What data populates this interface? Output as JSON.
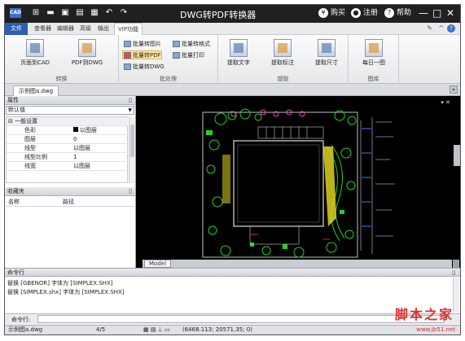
{
  "app": {
    "title": "DWG转PDF转换器",
    "icon_label": "CAD"
  },
  "titlebar": {
    "buy": "购买",
    "register": "注册",
    "help": "帮助",
    "minimize": "—",
    "maximize": "□",
    "close": "✕"
  },
  "menu_tabs": [
    "文件",
    "查看器",
    "编辑器",
    "高级",
    "输出",
    "VIP功能"
  ],
  "ribbon": {
    "groups": [
      {
        "label": "转换",
        "buttons": [
          "页面到CAD",
          "PDF到DWG"
        ]
      },
      {
        "label": "批处理",
        "buttons": [
          "批量转图片",
          "批量转格式",
          "批量转PDF",
          "批量打印",
          "批量转DWG"
        ]
      },
      {
        "label": "提取",
        "buttons": [
          "提取文字",
          "提取标注",
          "提取尺寸"
        ]
      },
      {
        "label": "图库",
        "buttons": [
          "每日一图"
        ]
      }
    ]
  },
  "doc_tab": "示例图a.dwg",
  "properties": {
    "header": "属性",
    "combo": "默认值",
    "rows": [
      {
        "k": "一般设置",
        "v": ""
      },
      {
        "k": "色彩",
        "v": "以图层"
      },
      {
        "k": "图层",
        "v": "0"
      },
      {
        "k": "线型",
        "v": "以图层"
      },
      {
        "k": "线型比例",
        "v": "1"
      },
      {
        "k": "线宽",
        "v": "以图层"
      }
    ]
  },
  "favorites": {
    "header": "收藏夹",
    "col_name": "名称",
    "col_path": "路径"
  },
  "cad": {
    "model_tab": "Model"
  },
  "command": {
    "header": "命令行",
    "lines": [
      "替换 [GBENOR] 字体为 [SIMPLEX.SHX]",
      "替换 [SIMPLEX.shx] 字体为 [SIMPLEX.SHX]"
    ],
    "label": "命令行:"
  },
  "status": {
    "file": "示例图a.dwg",
    "page": "4/5",
    "coords": "(6468.113; 20571,35; 0)"
  },
  "watermark": {
    "text": "脚本之家",
    "url": "www.jb51.net"
  }
}
